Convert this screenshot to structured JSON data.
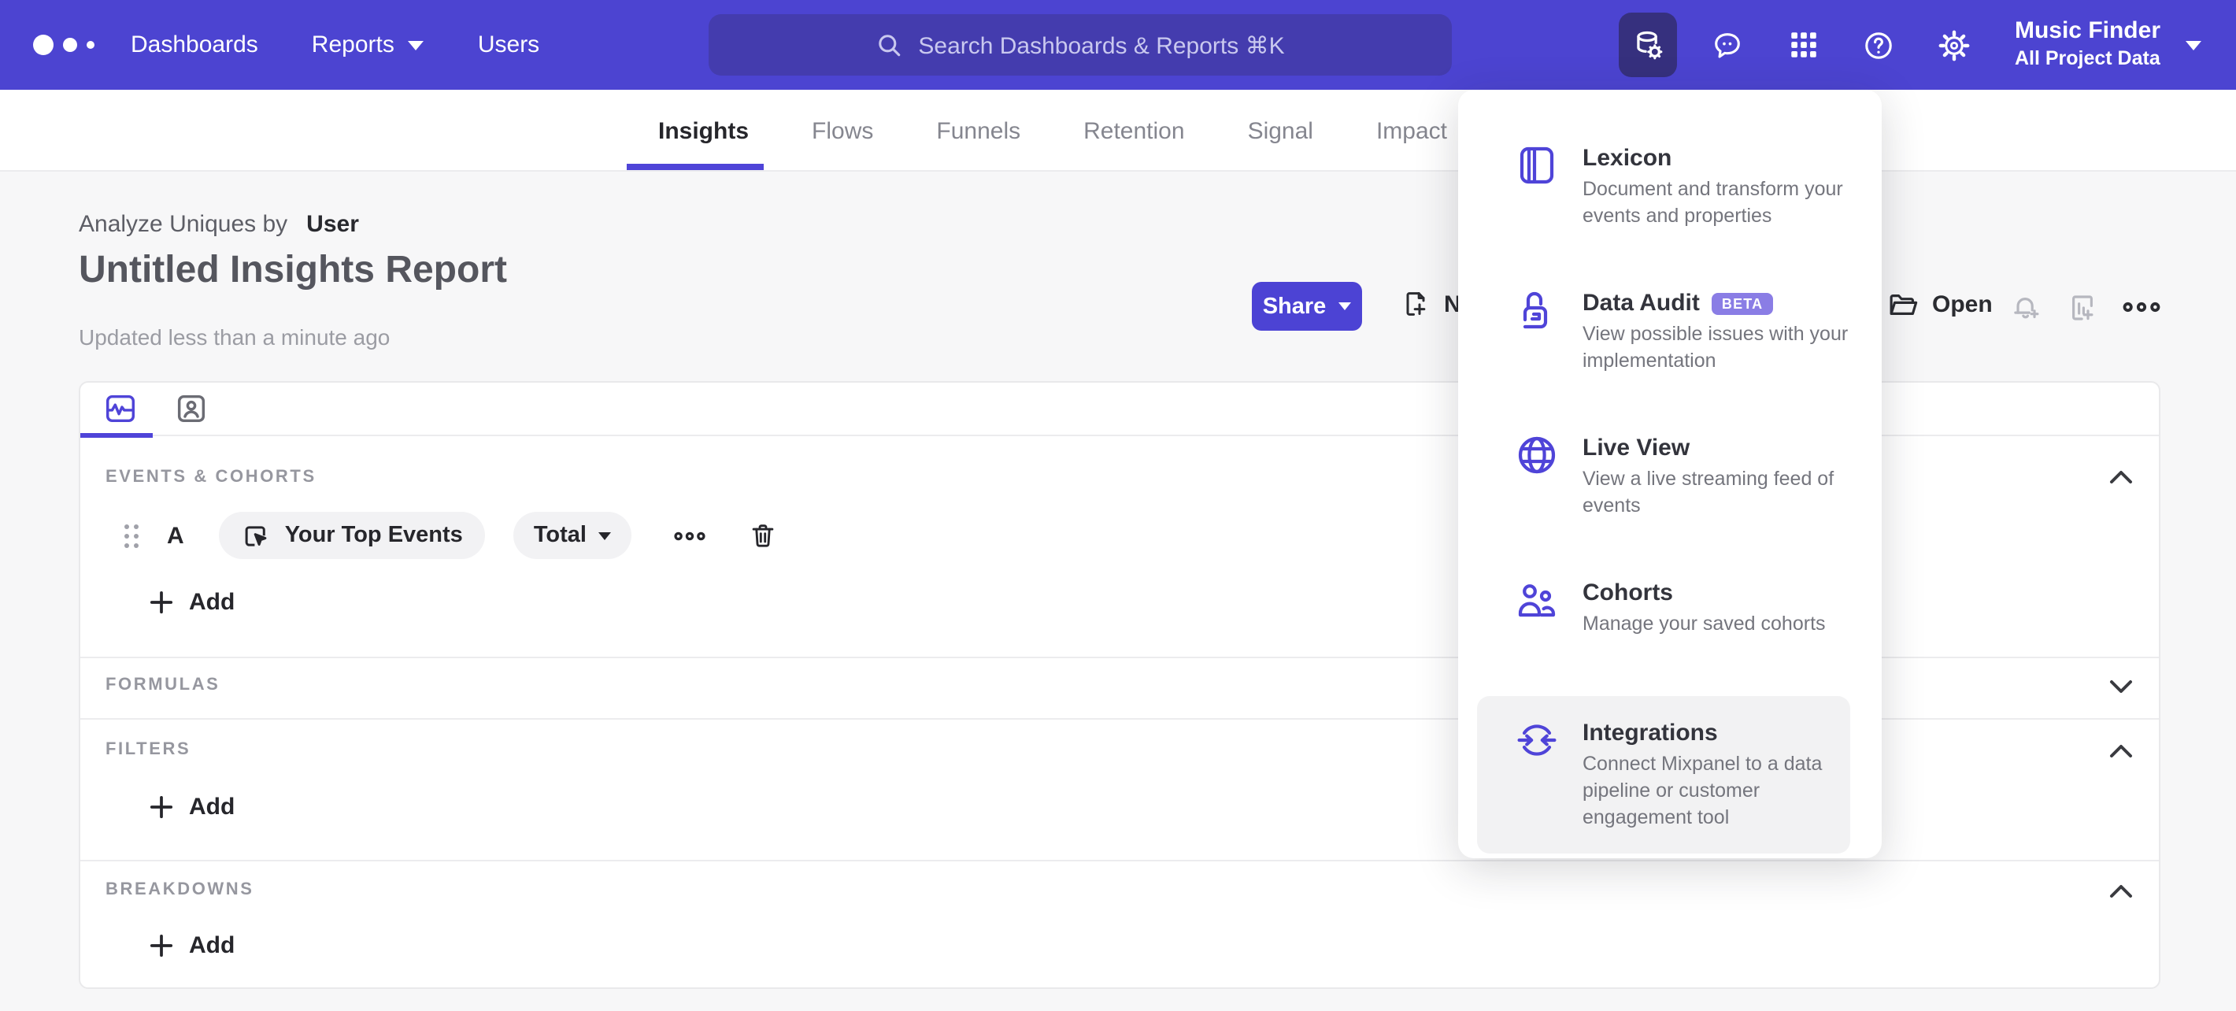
{
  "topnav": {
    "links": [
      {
        "label": "Dashboards"
      },
      {
        "label": "Reports"
      },
      {
        "label": "Users"
      }
    ],
    "search": {
      "placeholder": "Search Dashboards & Reports ⌘K"
    },
    "project": {
      "name": "Music Finder",
      "scope": "All Project Data"
    }
  },
  "tabbar": {
    "tabs": [
      {
        "label": "Insights"
      },
      {
        "label": "Flows"
      },
      {
        "label": "Funnels"
      },
      {
        "label": "Retention"
      },
      {
        "label": "Signal"
      },
      {
        "label": "Impact"
      }
    ]
  },
  "report": {
    "analyze_prefix": "Analyze Uniques by",
    "analyze_value": "User",
    "title": "Untitled Insights Report",
    "updated": "Updated less than a minute ago",
    "share_label": "Share",
    "new_label": "New",
    "open_label": "Open"
  },
  "menu": {
    "items": [
      {
        "title": "Lexicon",
        "description": "Document and transform your events and properties"
      },
      {
        "title": "Data Audit",
        "badge": "BETA",
        "description": "View possible issues with your implementation"
      },
      {
        "title": "Live View",
        "description": "View a live streaming feed of events"
      },
      {
        "title": "Cohorts",
        "description": "Manage your saved cohorts"
      },
      {
        "title": "Integrations",
        "description": "Connect Mixpanel to a data pipeline or customer engagement tool"
      }
    ]
  },
  "builder": {
    "sections": {
      "events": {
        "label": "EVENTS & COHORTS"
      },
      "formulas": {
        "label": "FORMULAS"
      },
      "filters": {
        "label": "FILTERS"
      },
      "breakdowns": {
        "label": "BREAKDOWNS"
      }
    },
    "event_row": {
      "letter": "A",
      "event_name": "Your Top Events",
      "aggregation": "Total"
    },
    "add_label": "Add"
  },
  "colors": {
    "nav_purple": "#4c44d1",
    "accent_purple": "#4f44d8",
    "search_bg": "#443cae",
    "active_tile": "#36307e",
    "page_bg": "#f7f7f8",
    "beta_badge": "#8a7de5"
  }
}
